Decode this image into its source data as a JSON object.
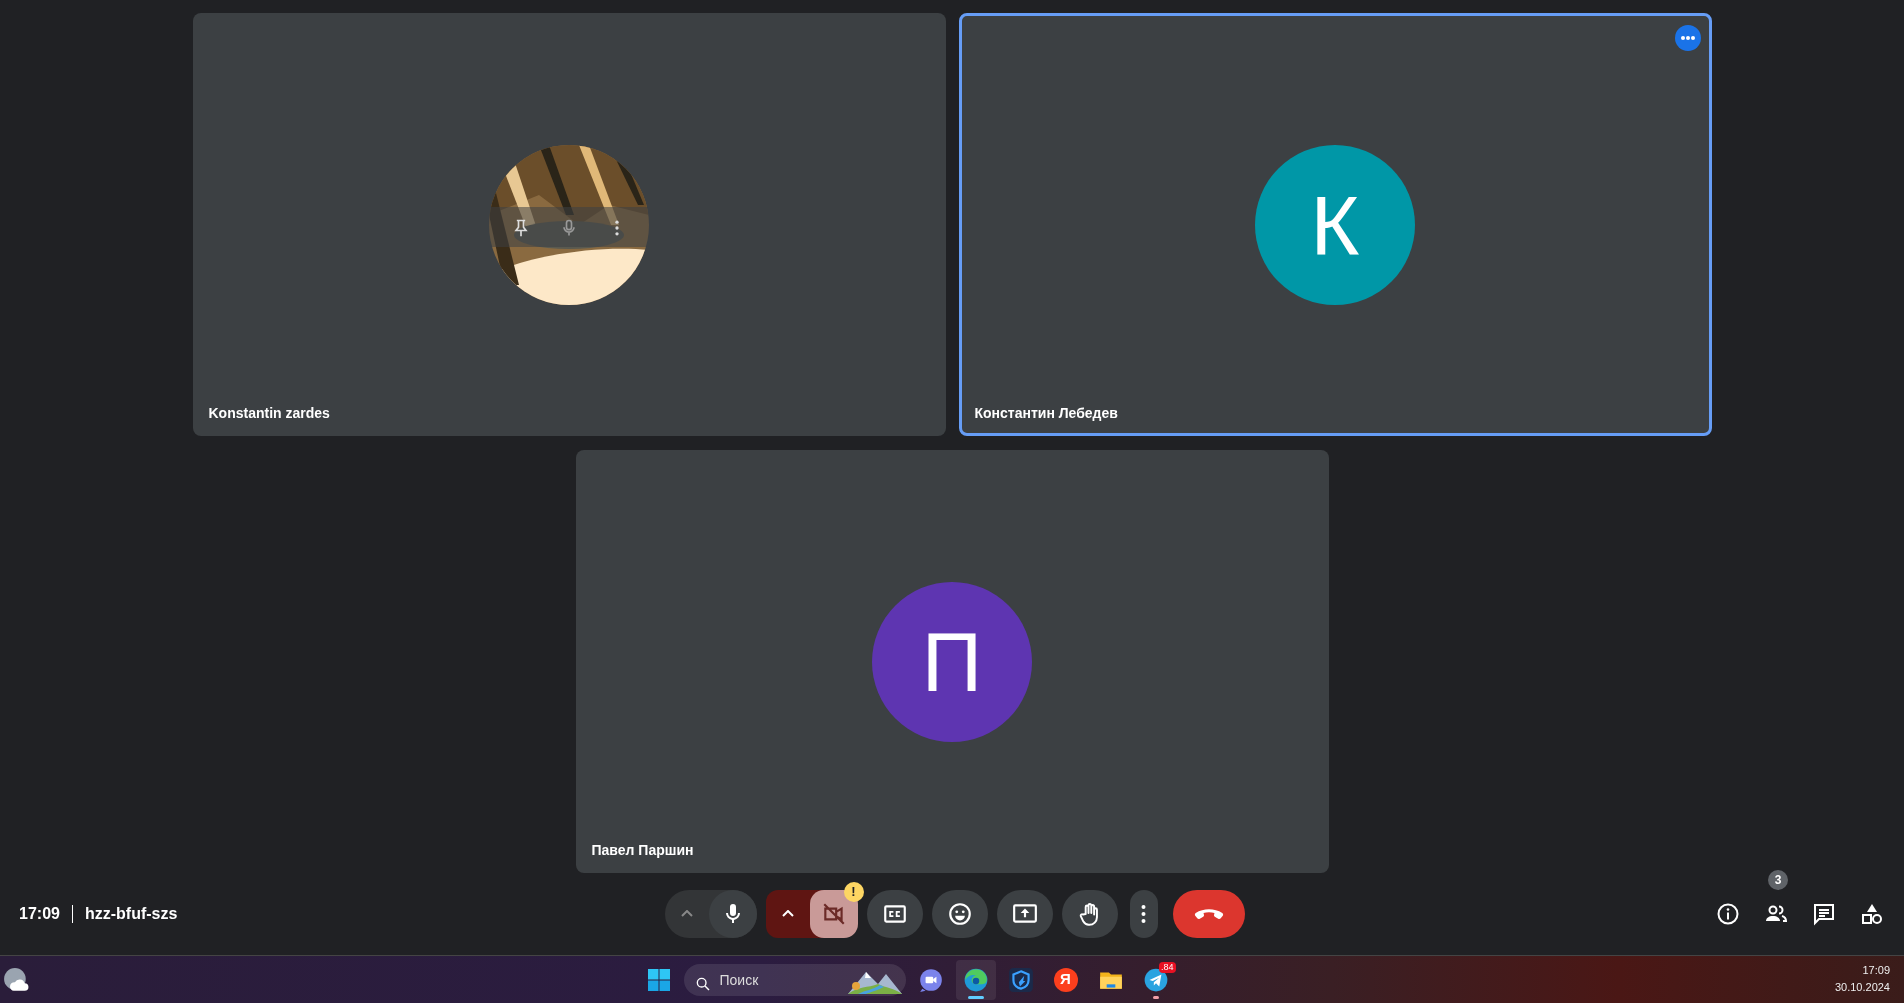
{
  "tiles": [
    {
      "name": "Konstantin zardes",
      "selected": false,
      "hover_controls": true,
      "menu_button": false
    },
    {
      "name": "Константин Лебедев",
      "avatar": {
        "kind": "letter",
        "letter": "К",
        "color": "#0097a7"
      },
      "selected": true,
      "hover_controls": false,
      "menu_button": true
    },
    {
      "name": "Павел Паршин",
      "avatar": {
        "kind": "letter",
        "letter": "П",
        "color": "#5e35b1"
      },
      "selected": false,
      "hover_controls": false,
      "menu_button": false
    }
  ],
  "meeting": {
    "time": "17:09",
    "code": "hzz-bfuf-szs"
  },
  "controls": [
    {
      "kind": "mic",
      "muted": false
    },
    {
      "kind": "camera",
      "muted": true,
      "warning": "!"
    },
    {
      "kind": "captions"
    },
    {
      "kind": "emoji"
    },
    {
      "kind": "present"
    },
    {
      "kind": "hand"
    },
    {
      "kind": "more"
    },
    {
      "kind": "end"
    }
  ],
  "side_buttons": [
    {
      "kind": "info"
    },
    {
      "kind": "people",
      "badge": "3"
    },
    {
      "kind": "chat"
    },
    {
      "kind": "activities"
    }
  ],
  "taskbar": {
    "search": {
      "placeholder": "Поиск"
    },
    "apps": [
      {
        "kind": "meet",
        "active": false
      },
      {
        "kind": "edge",
        "active": true
      },
      {
        "kind": "shield",
        "active": false
      },
      {
        "kind": "yandex",
        "label": "Я",
        "active": false
      },
      {
        "kind": "folder",
        "active": false
      },
      {
        "kind": "telegram",
        "badge": ".84",
        "active": false,
        "running": true
      }
    ],
    "clock": {
      "time": "17:09",
      "date": "30.10.2024"
    }
  }
}
